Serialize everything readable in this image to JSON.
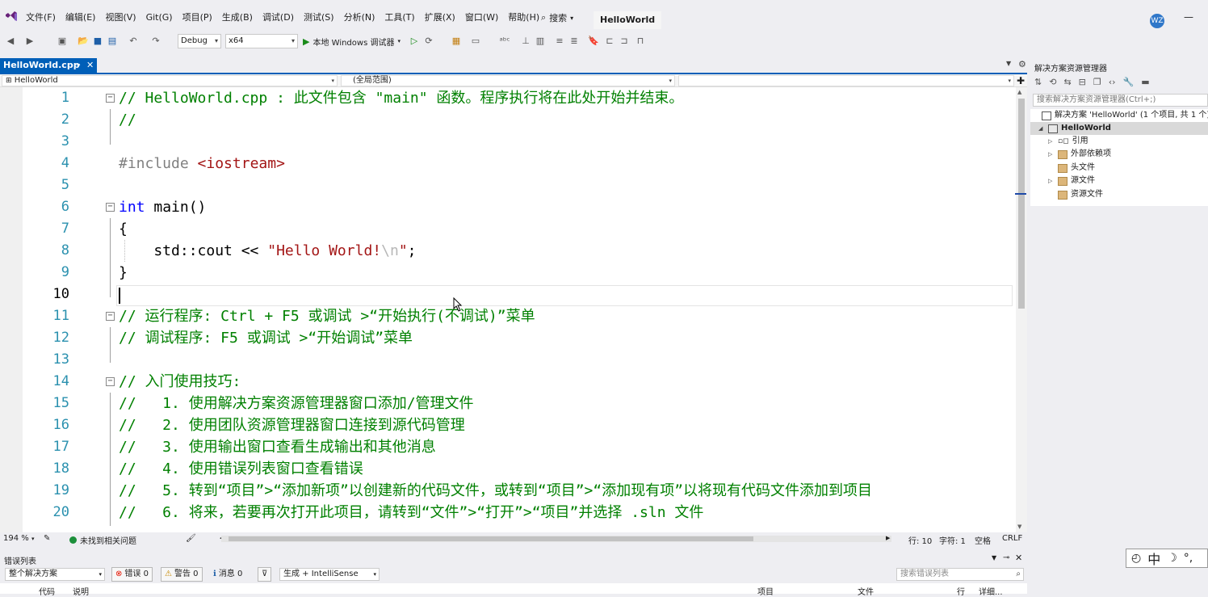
{
  "menubar": {
    "items": [
      "文件(F)",
      "编辑(E)",
      "视图(V)",
      "Git(G)",
      "项目(P)",
      "生成(B)",
      "调试(D)",
      "测试(S)",
      "分析(N)",
      "工具(T)",
      "扩展(X)",
      "窗口(W)",
      "帮助(H)"
    ],
    "search_label": "搜索",
    "solution_title": "HelloWorld",
    "avatar_initials": "WZ"
  },
  "toolbar": {
    "config": "Debug",
    "platform": "x64",
    "run_label": "本地 Windows 调试器"
  },
  "editor": {
    "tab_label": "HelloWorld.cpp",
    "nav_project": "HelloWorld",
    "nav_scope": "(全局范围)",
    "current_line": 10,
    "lines": [
      {
        "n": "1",
        "comment": "// HelloWorld.cpp : 此文件包含 \"main\" 函数。程序执行将在此处开始并结束。"
      },
      {
        "n": "2",
        "comment": "//"
      },
      {
        "n": "3"
      },
      {
        "n": "4",
        "pre": "#include ",
        "header": "<iostream>"
      },
      {
        "n": "5"
      },
      {
        "n": "6",
        "kw": "int",
        "rest": " main()"
      },
      {
        "n": "7",
        "rest": "{"
      },
      {
        "n": "8",
        "rest": "    std::cout << ",
        "str": "\"Hello World!",
        "esc": "\\n",
        "str2": "\"",
        "rest2": ";"
      },
      {
        "n": "9",
        "rest": "}"
      },
      {
        "n": "10"
      },
      {
        "n": "11",
        "comment": "// 运行程序: Ctrl + F5 或调试 >“开始执行(不调试)”菜单"
      },
      {
        "n": "12",
        "comment": "// 调试程序: F5 或调试 >“开始调试”菜单"
      },
      {
        "n": "13"
      },
      {
        "n": "14",
        "comment": "// 入门使用技巧:"
      },
      {
        "n": "15",
        "comment": "//   1. 使用解决方案资源管理器窗口添加/管理文件"
      },
      {
        "n": "16",
        "comment": "//   2. 使用团队资源管理器窗口连接到源代码管理"
      },
      {
        "n": "17",
        "comment": "//   3. 使用输出窗口查看生成输出和其他消息"
      },
      {
        "n": "18",
        "comment": "//   4. 使用错误列表窗口查看错误"
      },
      {
        "n": "19",
        "comment": "//   5. 转到“项目”>“添加新项”以创建新的代码文件，或转到“项目”>“添加现有项”以将现有代码文件添加到项目"
      },
      {
        "n": "20",
        "comment": "//   6. 将来，若要再次打开此项目，请转到“文件”>“打开”>“项目”并选择 .sln 文件"
      }
    ]
  },
  "status": {
    "zoom": "194 %",
    "health": "未找到相关问题",
    "line": "行: 10",
    "col": "字符: 1",
    "whitespace": "空格",
    "eol": "CRLF"
  },
  "errorlist": {
    "title": "错误列表",
    "scope": "整个解决方案",
    "errors": "错误 0",
    "warnings": "警告 0",
    "messages": "消息 0",
    "source": "生成 + IntelliSense",
    "search_placeholder": "搜索错误列表",
    "columns": [
      "代码",
      "说明",
      "项目",
      "文件",
      "行",
      "详细..."
    ]
  },
  "solution_explorer": {
    "title": "解决方案资源管理器",
    "search_placeholder": "搜索解决方案资源管理器(Ctrl+;)",
    "solution_node": "解决方案 'HelloWorld' (1 个项目, 共 1 个)",
    "project_node": "HelloWorld",
    "children": [
      "引用",
      "外部依赖项",
      "头文件",
      "源文件",
      "资源文件"
    ]
  },
  "ime": {
    "mode": "中"
  },
  "colors": {
    "accent": "#005fb8",
    "comment": "#008000",
    "keyword": "#0000ff",
    "string": "#a31515",
    "line_number": "#2b91af"
  }
}
